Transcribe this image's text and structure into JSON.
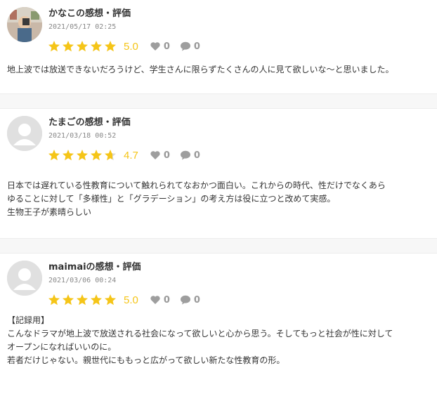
{
  "colors": {
    "star": "#f5c518",
    "icon": "#9e9e9e",
    "text": "#333333"
  },
  "reviews": [
    {
      "name": "かなこの感想・評価",
      "date": "2021/05/17 02:25",
      "rating": 5.0,
      "score_text": "5.0",
      "likes": "0",
      "comments": "0",
      "avatar": "photo",
      "lines": [
        "地上波では放送できないだろうけど、学生さんに限らずたくさんの人に見て欲しいな〜と思いました。"
      ]
    },
    {
      "name": "たまごの感想・評価",
      "date": "2021/03/18 00:52",
      "rating": 4.7,
      "score_text": "4.7",
      "likes": "0",
      "comments": "0",
      "avatar": "default",
      "lines": [
        "日本では遅れている性教育について触れられてなおかつ面白い。これからの時代、性だけでなくあら",
        "ゆることに対して「多様性」と「グラデーション」の考え方は役に立つと改めて実感。",
        "生物王子が素晴らしい"
      ]
    },
    {
      "name": "maimaiの感想・評価",
      "date": "2021/03/06 00:24",
      "rating": 5.0,
      "score_text": "5.0",
      "likes": "0",
      "comments": "0",
      "avatar": "default",
      "lines": [
        "【記録用】",
        "こんなドラマが地上波で放送される社会になって欲しいと心から思う。そしてもっと社会が性に対して",
        "オープンになればいいのに。",
        "若者だけじゃない。親世代にももっと広がって欲しい新たな性教育の形。"
      ]
    }
  ]
}
